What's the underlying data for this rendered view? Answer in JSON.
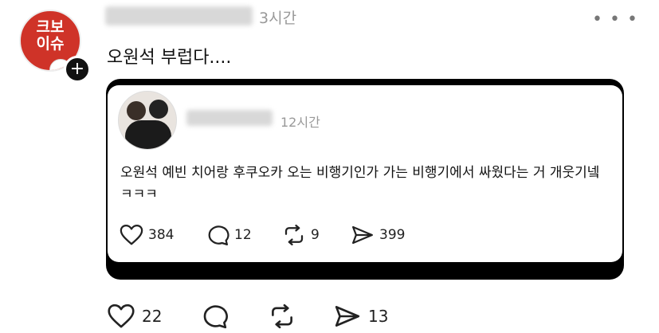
{
  "post": {
    "time": "3시간",
    "text": "오원석 부럽다....",
    "avatar_text": "크보\n이슈",
    "plus": "+",
    "more": "• • •",
    "stats": {
      "likes": "22",
      "shares": "13"
    }
  },
  "quote": {
    "time": "12시간",
    "text": "오원석 예빈 치어랑 후쿠오카 오는 비행기인가 가는 비행기에서 싸웠다는 거 개웃기넼ㅋㅋㅋ",
    "stats": {
      "likes": "384",
      "replies": "12",
      "reposts": "9",
      "shares": "399"
    }
  },
  "icons": [
    "heart-icon",
    "comment-icon",
    "repost-icon",
    "share-icon",
    "more-icon",
    "plus-icon"
  ]
}
